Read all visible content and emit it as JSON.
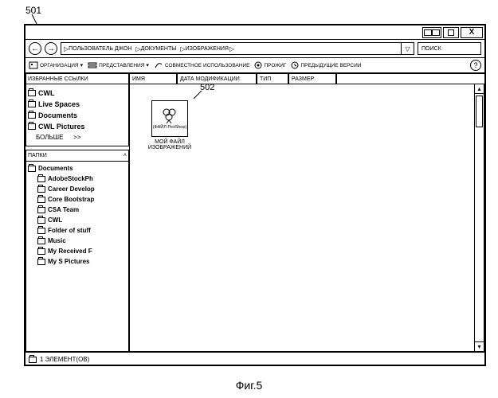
{
  "figure": {
    "ref_top": "501",
    "ref_file": "502",
    "caption": "Фиг.5"
  },
  "titlebar": {
    "close": "X"
  },
  "nav": {
    "crumbs": [
      "ПОЛЬЗОВАТЕЛЬ ДЖОН",
      "ДОКУМЕНТЫ",
      "ИЗОБРАЖЕНИЯ"
    ],
    "search_placeholder": "ПОИСК"
  },
  "toolbar": {
    "organize": "ОРГАНИЗАЦИЯ",
    "views": "ПРЕДСТАВЛЕНИЯ",
    "share": "СОВМЕСТНОЕ ИСПОЛЬЗОВАНИЕ",
    "burn": "ПРОЖИГ",
    "prev_versions": "ПРЕДЫДУЩИЕ ВЕРСИИ",
    "help": "?"
  },
  "sidebar": {
    "fav_header": "ИЗБРАННЫЕ ССЫЛКИ",
    "favs": [
      "CWL",
      "Live Spaces",
      "Documents",
      "CWL Pictures"
    ],
    "more": "БОЛЬШЕ",
    "more_arrow": ">>",
    "folders_header": "ПАПКИ",
    "root": "Documents",
    "children": [
      "AdobeStockPh",
      "Career Develop",
      "Core Bootstrap",
      "CSA Team",
      "CWL",
      "Folder of stuff",
      "Music",
      "My Received F",
      "My S Pictures"
    ]
  },
  "columns": [
    "ИМЯ",
    "ДАТА МОДИФИКАЦИИ",
    "ТИП",
    "РАЗМЕР"
  ],
  "file": {
    "icon_label": "(ФАЙЛ PictShop)",
    "name": "МОЙ ФАЙЛ ИЗОБРАЖЕНИЙ"
  },
  "status": "1 ЭЛЕМЕНТ(ОВ)"
}
